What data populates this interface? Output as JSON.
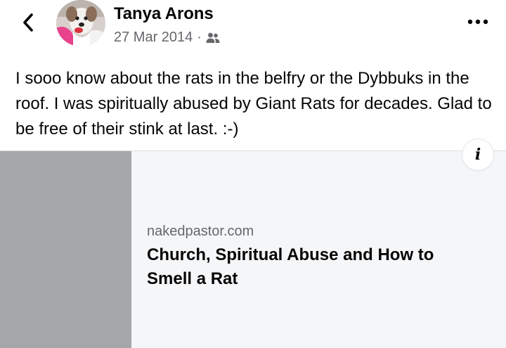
{
  "post": {
    "author_name": "Tanya Arons",
    "date": "27 Mar 2014",
    "separator": "·",
    "audience_icon": "friends-icon",
    "text": "I sooo know about the rats in the belfry or the Dybbuks in the roof.  I was spiritually abused by Giant Rats for decades.  Glad to be free of their stink at last. :-)"
  },
  "header": {
    "back_icon": "chevron-left-icon",
    "more_icon": "more-horizontal-icon"
  },
  "link_card": {
    "domain": "nakedpastor.com",
    "title": "Church, Spiritual Abuse and How to Smell a Rat",
    "info_label": "i",
    "thumbnail_color": "#a3a7aa"
  },
  "colors": {
    "text_primary": "#050505",
    "text_secondary": "#65676b",
    "card_background": "#f5f6f8"
  }
}
